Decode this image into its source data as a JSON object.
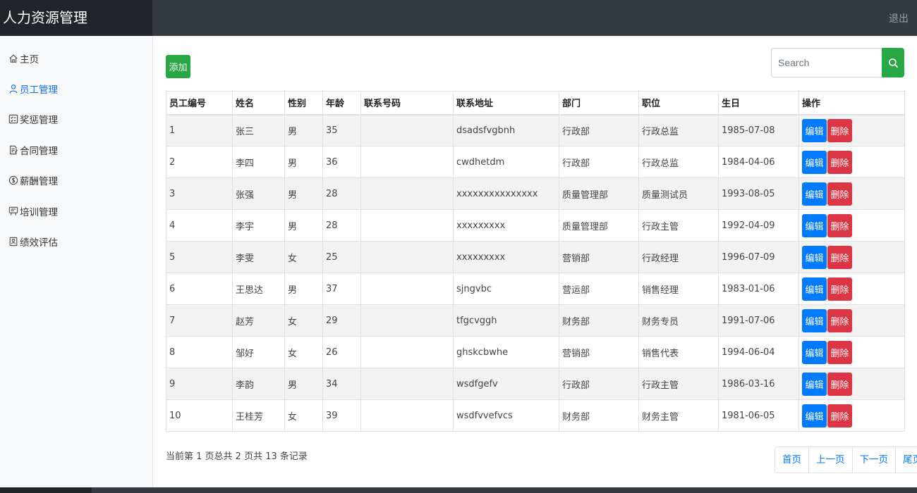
{
  "app": {
    "title": "人力资源管理",
    "logout_label": "退出"
  },
  "sidebar": {
    "items": [
      {
        "label": "主页",
        "icon": "house-icon"
      },
      {
        "label": "员工管理",
        "icon": "person-icon",
        "active": true
      },
      {
        "label": "奖惩管理",
        "icon": "checklist-icon"
      },
      {
        "label": "合同管理",
        "icon": "contract-icon"
      },
      {
        "label": "薪酬管理",
        "icon": "currency-icon"
      },
      {
        "label": "培训管理",
        "icon": "training-icon"
      },
      {
        "label": "绩效评估",
        "icon": "report-icon"
      }
    ]
  },
  "toolbar": {
    "add_label": "添加",
    "search_placeholder": "Search",
    "search_icon": "search-icon"
  },
  "table": {
    "headers": [
      "员工编号",
      "姓名",
      "性别",
      "年龄",
      "联系号码",
      "联系地址",
      "部门",
      "职位",
      "生日",
      "操作"
    ],
    "edit_label": "编辑",
    "delete_label": "删除",
    "rows": [
      {
        "id": "1",
        "name": "张三",
        "gender": "男",
        "age": "35",
        "phone": "",
        "address": "dsadsfvgbnh",
        "dept": "行政部",
        "position": "行政总监",
        "birthday": "1985-07-08"
      },
      {
        "id": "2",
        "name": "李四",
        "gender": "男",
        "age": "36",
        "phone": "",
        "address": "cwdhetdm",
        "dept": "行政部",
        "position": "行政总监",
        "birthday": "1984-04-06"
      },
      {
        "id": "3",
        "name": "张强",
        "gender": "男",
        "age": "28",
        "phone": "",
        "address": "xxxxxxxxxxxxxxx",
        "dept": "质量管理部",
        "position": "质量测试员",
        "birthday": "1993-08-05"
      },
      {
        "id": "4",
        "name": "李宇",
        "gender": "男",
        "age": "28",
        "phone": "",
        "address": "xxxxxxxxx",
        "dept": "质量管理部",
        "position": "行政主管",
        "birthday": "1992-04-09"
      },
      {
        "id": "5",
        "name": "李雯",
        "gender": "女",
        "age": "25",
        "phone": "",
        "address": "xxxxxxxxx",
        "dept": "营销部",
        "position": "行政经理",
        "birthday": "1996-07-09"
      },
      {
        "id": "6",
        "name": "王思达",
        "gender": "男",
        "age": "37",
        "phone": "",
        "address": "sjngvbc",
        "dept": "营运部",
        "position": "销售经理",
        "birthday": "1983-01-06"
      },
      {
        "id": "7",
        "name": "赵芳",
        "gender": "女",
        "age": "29",
        "phone": "",
        "address": "tfgcvggh",
        "dept": "财务部",
        "position": "财务专员",
        "birthday": "1991-07-06"
      },
      {
        "id": "8",
        "name": "邹好",
        "gender": "女",
        "age": "26",
        "phone": "",
        "address": "ghskcbwhe",
        "dept": "营销部",
        "position": "销售代表",
        "birthday": "1994-06-04"
      },
      {
        "id": "9",
        "name": "李韵",
        "gender": "男",
        "age": "34",
        "phone": "",
        "address": "wsdfgefv",
        "dept": "行政部",
        "position": "行政主管",
        "birthday": "1986-03-16"
      },
      {
        "id": "10",
        "name": "王桂芳",
        "gender": "女",
        "age": "39",
        "phone": "",
        "address": "wsdfvvefvcs",
        "dept": "财务部",
        "position": "财务主管",
        "birthday": "1981-06-05"
      }
    ]
  },
  "pagination": {
    "info": "当前第 1 页总共 2 页共 13 条记录",
    "first": "首页",
    "prev": "上一页",
    "next": "下一页",
    "last": "尾页"
  },
  "colors": {
    "topbar": "#343a40",
    "brand_bg": "#212529",
    "primary": "#007bff",
    "success": "#28a745",
    "danger": "#dc3545",
    "active_nav": "#0d6efd"
  }
}
